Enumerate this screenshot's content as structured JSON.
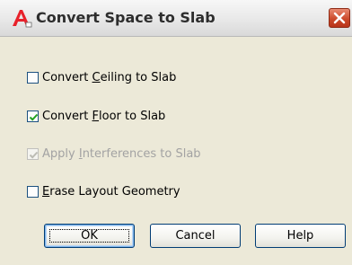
{
  "window": {
    "title": "Convert Space to Slab",
    "app_icon": "autocad-a-icon",
    "close_icon": "close-icon"
  },
  "options": [
    {
      "pre": "Convert ",
      "accel": "C",
      "post": "eiling to Slab",
      "checked": false,
      "enabled": true
    },
    {
      "pre": "Convert ",
      "accel": "F",
      "post": "loor to Slab",
      "checked": true,
      "enabled": true
    },
    {
      "pre": "Apply ",
      "accel": "I",
      "post": "nterferences to Slab",
      "checked": true,
      "enabled": false
    },
    {
      "pre": "",
      "accel": "E",
      "post": "rase Layout Geometry",
      "checked": false,
      "enabled": true
    }
  ],
  "buttons": {
    "ok": "OK",
    "cancel": "Cancel",
    "help": "Help"
  },
  "colors": {
    "dialog_bg": "#ece9d8",
    "close_red": "#cc4a2b",
    "check_green": "#21a121",
    "disabled_text": "#a3a3a3"
  }
}
